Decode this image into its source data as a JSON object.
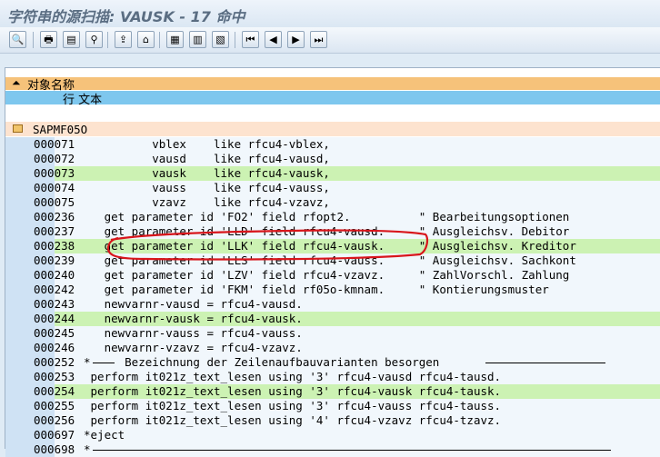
{
  "window": {
    "title": "字符串的源扫描:  VAUSK - 17 命中"
  },
  "toolbar": {
    "buttons": [
      {
        "name": "details-icon",
        "glyph": "🔍"
      },
      {
        "name": "print-icon",
        "glyph": "🖶"
      },
      {
        "name": "sort-icon",
        "glyph": "▤"
      },
      {
        "name": "filter-icon",
        "glyph": "⚲"
      },
      {
        "name": "export-icon",
        "glyph": "⇪"
      },
      {
        "name": "layout-icon",
        "glyph": "⌂"
      },
      {
        "name": "grid-icon",
        "glyph": "▦"
      },
      {
        "name": "table-icon",
        "glyph": "▥"
      },
      {
        "name": "columns-icon",
        "glyph": "▧"
      },
      {
        "name": "first-page-icon",
        "glyph": "⏮"
      },
      {
        "name": "prev-page-icon",
        "glyph": "◀"
      },
      {
        "name": "next-page-icon",
        "glyph": "▶"
      },
      {
        "name": "last-page-icon",
        "glyph": "⏭"
      }
    ]
  },
  "list_header": {
    "col1": "对象名称",
    "col2": "行 文本"
  },
  "group": {
    "object": "SAPMF05O"
  },
  "rows": [
    {
      "line": "000071",
      "text": "          vblex    like rfcu4-vblex,",
      "hl": false
    },
    {
      "line": "000072",
      "text": "          vausd    like rfcu4-vausd,",
      "hl": false
    },
    {
      "line": "000073",
      "text": "          vausk    like rfcu4-vausk,",
      "hl": true
    },
    {
      "line": "000074",
      "text": "          vauss    like rfcu4-vauss,",
      "hl": false
    },
    {
      "line": "000075",
      "text": "          vzavz    like rfcu4-vzavz,",
      "hl": false
    },
    {
      "line": "000236",
      "text": "   get parameter id 'FO2' field rfopt2.          \" Bearbeitungsoptionen",
      "hl": false
    },
    {
      "line": "000237",
      "text": "   get parameter id 'LLD' field rfcu4-vausd.     \" Ausgleichsv. Debitor",
      "hl": false
    },
    {
      "line": "000238",
      "text": "   get parameter id 'LLK' field rfcu4-vausk.     \" Ausgleichsv. Kreditor",
      "hl": true
    },
    {
      "line": "000239",
      "text": "   get parameter id 'LLS' field rfcu4-vauss.     \" Ausgleichsv. Sachkont",
      "hl": false
    },
    {
      "line": "000240",
      "text": "   get parameter id 'LZV' field rfcu4-vzavz.     \" ZahlVorschl. Zahlung",
      "hl": false
    },
    {
      "line": "000242",
      "text": "   get parameter id 'FKM' field rf05o-kmnam.     \" Kontierungsmuster",
      "hl": false
    },
    {
      "line": "000243",
      "text": "   newvarnr-vausd = rfcu4-vausd.",
      "hl": false
    },
    {
      "line": "000244",
      "text": "   newvarnr-vausk = rfcu4-vausk.",
      "hl": true
    },
    {
      "line": "000245",
      "text": "   newvarnr-vauss = rfcu4-vauss.",
      "hl": false
    },
    {
      "line": "000246",
      "text": "   newvarnr-vzavz = rfcu4-vzavz.",
      "hl": false
    },
    {
      "line": "000252",
      "text": "*     Bezeichnung der Zeilenaufbauvarianten besorgen",
      "hl": false
    },
    {
      "line": "000253",
      "text": " perform it021z_text_lesen using '3' rfcu4-vausd rfcu4-tausd.",
      "hl": false
    },
    {
      "line": "000254",
      "text": " perform it021z_text_lesen using '3' rfcu4-vausk rfcu4-tausk.",
      "hl": true
    },
    {
      "line": "000255",
      "text": " perform it021z_text_lesen using '3' rfcu4-vauss rfcu4-tauss.",
      "hl": false
    },
    {
      "line": "000256",
      "text": " perform it021z_text_lesen using '4' rfcu4-vzavz rfcu4-tzavz.",
      "hl": false
    },
    {
      "line": "000697",
      "text": "*eject",
      "hl": false
    },
    {
      "line": "000698",
      "text": "*",
      "hl": false
    }
  ]
}
